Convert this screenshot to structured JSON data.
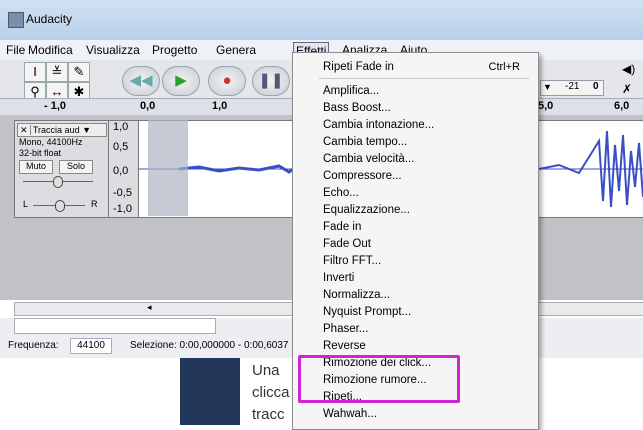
{
  "window": {
    "title": "Audacity"
  },
  "menubar": {
    "items": [
      "File",
      "Modifica",
      "Visualizza",
      "Progetto",
      "Genera",
      "Effetti",
      "Analizza",
      "Aiuto"
    ],
    "active": "Effetti"
  },
  "ruler": {
    "labels": [
      "- 1,0",
      "0,0",
      "1,0",
      "5,0",
      "6,0"
    ]
  },
  "meter": {
    "value": "-21",
    "value2": "0"
  },
  "track": {
    "name": "Traccia aud",
    "info_rate": "Mono, 44100Hz",
    "info_format": "32-bit float",
    "mute": "Muto",
    "solo": "Solo",
    "pan_l": "L",
    "pan_r": "R",
    "scale": [
      "1,0",
      "0,5",
      "0,0",
      "-0,5",
      "-1,0"
    ]
  },
  "status": {
    "freq_label": "Frequenza:",
    "freq_value": "44100",
    "selection": "Selezione: 0:00,000000 - 0:00,6037"
  },
  "doc": {
    "line1": "Una",
    "line2": "clicca",
    "line3": "tracc"
  },
  "effects_menu": {
    "repeat": {
      "label": "Ripeti Fade in",
      "shortcut": "Ctrl+R"
    },
    "items": [
      "Amplifica...",
      "Bass Boost...",
      "Cambia intonazione...",
      "Cambia tempo...",
      "Cambia velocità...",
      "Compressore...",
      "Echo...",
      "Equalizzazione...",
      "Fade in",
      "Fade Out",
      "Filtro FFT...",
      "Inverti",
      "Normalizza...",
      "Nyquist Prompt...",
      "Phaser...",
      "Reverse",
      "Rimozione dei click...",
      "Rimozione rumore...",
      "Ripeti...",
      "Wahwah..."
    ]
  },
  "colors": {
    "highlight": "#d025d6",
    "waveform": "#3b4fc4"
  }
}
